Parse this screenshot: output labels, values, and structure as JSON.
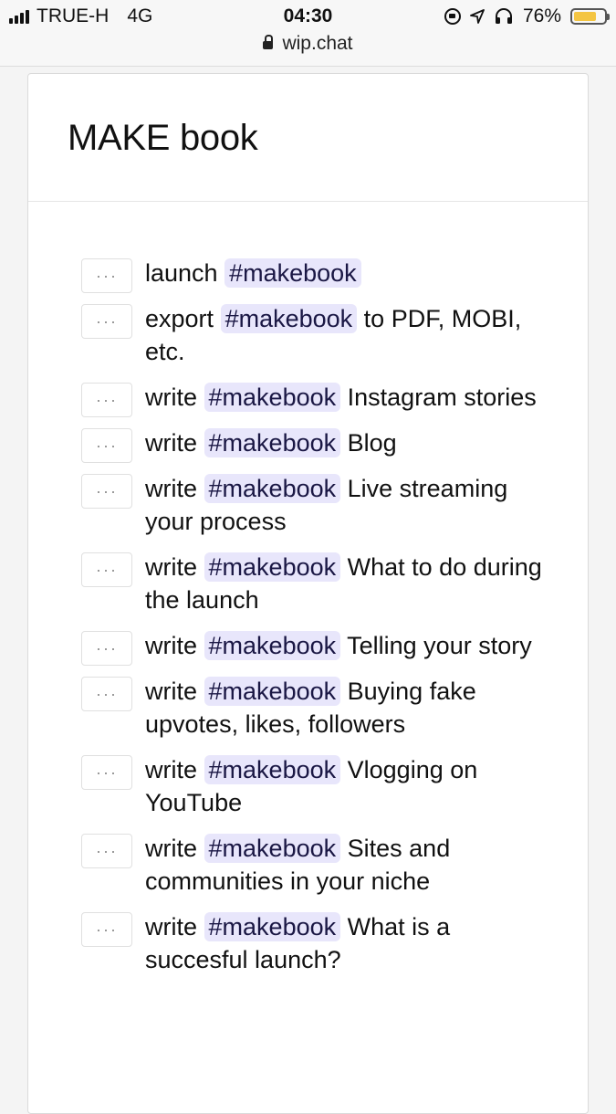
{
  "status_bar": {
    "carrier": "TRUE-H",
    "network": "4G",
    "time": "04:30",
    "url": "wip.chat",
    "battery": "76%",
    "battery_level": 0.76,
    "icons": [
      "signal-icon",
      "lock-icon",
      "rotation-lock-icon",
      "location-icon",
      "headphones-icon",
      "battery-icon"
    ],
    "battery_color": "#f4c542"
  },
  "page": {
    "title": "MAKE book"
  },
  "colors": {
    "hashtag_bg": "#e8e6fb",
    "hashtag_text": "#1a1744"
  },
  "todos": [
    {
      "before": "launch",
      "tag": "#makebook",
      "after": ""
    },
    {
      "before": "export",
      "tag": "#makebook",
      "after": "to PDF, MOBI, etc."
    },
    {
      "before": "write",
      "tag": "#makebook",
      "after": "Instagram stories"
    },
    {
      "before": "write",
      "tag": "#makebook",
      "after": "Blog"
    },
    {
      "before": "write",
      "tag": "#makebook",
      "after": "Live streaming your process"
    },
    {
      "before": "write",
      "tag": "#makebook",
      "after": "What to do during the launch"
    },
    {
      "before": "write",
      "tag": "#makebook",
      "after": "Telling your story"
    },
    {
      "before": "write",
      "tag": "#makebook",
      "after": "Buying fake upvotes, likes, followers"
    },
    {
      "before": "write",
      "tag": "#makebook",
      "after": "Vlogging on YouTube"
    },
    {
      "before": "write",
      "tag": "#makebook",
      "after": "Sites and communities in your niche"
    },
    {
      "before": "write",
      "tag": "#makebook",
      "after": "What is a succesful launch?"
    }
  ],
  "menu_button_label": "···"
}
